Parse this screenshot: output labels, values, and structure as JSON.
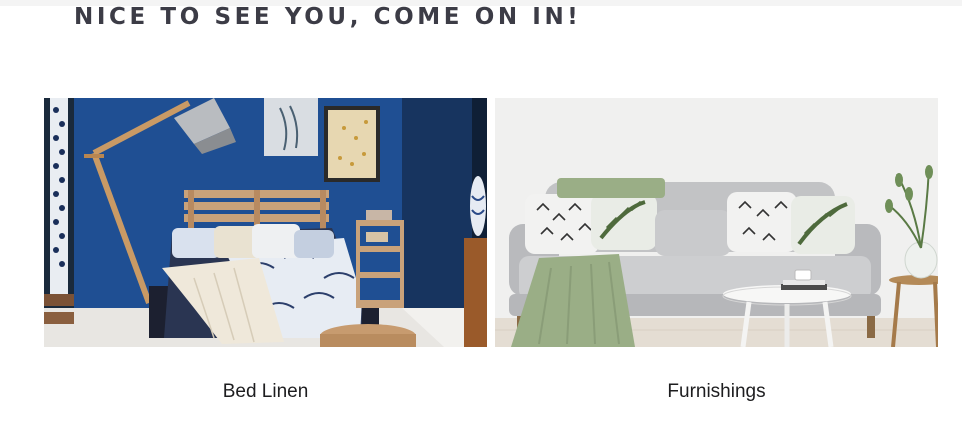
{
  "page": {
    "heading": "NICE TO SEE YOU, COME ON IN!"
  },
  "categories": [
    {
      "label": "Bed Linen"
    },
    {
      "label": "Furnishings"
    }
  ],
  "colors": {
    "heading": "#3c3c46",
    "label": "#1d1d1f",
    "bedroom_wall": "#1f4f93",
    "sofa": "#c2c3c5",
    "throw": "#9aae86"
  }
}
